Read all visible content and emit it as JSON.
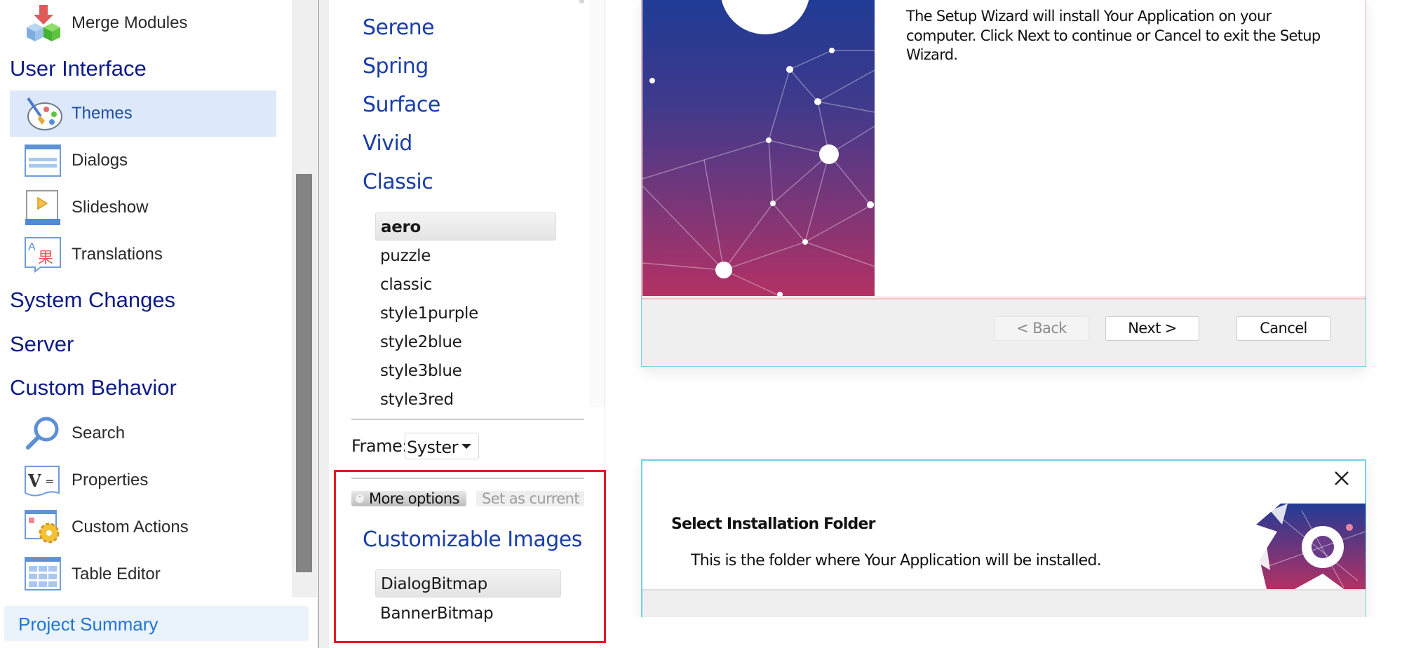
{
  "sidebar": {
    "top_item": {
      "label": "Merge Modules",
      "icon": "merge-modules-icon"
    },
    "sections": [
      {
        "title": "User Interface",
        "items": [
          {
            "label": "Themes",
            "icon": "palette-icon",
            "selected": true
          },
          {
            "label": "Dialogs",
            "icon": "dialog-window-icon"
          },
          {
            "label": "Slideshow",
            "icon": "slideshow-play-icon"
          },
          {
            "label": "Translations",
            "icon": "translation-icon"
          }
        ]
      },
      {
        "title": "System Changes",
        "items": []
      },
      {
        "title": "Server",
        "items": []
      },
      {
        "title": "Custom Behavior",
        "items": [
          {
            "label": "Search",
            "icon": "magnifier-icon"
          },
          {
            "label": "Properties",
            "icon": "properties-v-icon"
          },
          {
            "label": "Custom Actions",
            "icon": "gear-window-icon"
          },
          {
            "label": "Table Editor",
            "icon": "table-icon"
          }
        ]
      }
    ],
    "project_summary": "Project Summary"
  },
  "themes_panel": {
    "theme_groups": [
      "Serene",
      "Spring",
      "Surface",
      "Vivid",
      "Classic"
    ],
    "classic_styles": [
      {
        "label": "aero",
        "selected": true
      },
      {
        "label": "puzzle"
      },
      {
        "label": "classic"
      },
      {
        "label": "style1purple"
      },
      {
        "label": "style2blue"
      },
      {
        "label": "style3blue"
      },
      {
        "label": "style3red"
      }
    ],
    "frame_label": "Frame:",
    "frame_value": "Syster",
    "more_options_label": "More options",
    "set_as_current_label": "Set as current",
    "customizable_images_heading": "Customizable Images",
    "images": [
      {
        "label": "DialogBitmap",
        "selected": true
      },
      {
        "label": "BannerBitmap"
      }
    ],
    "highlight_color": "#e41b23"
  },
  "preview_welcome": {
    "description": "The Setup Wizard will install Your Application on your computer. Click Next to continue or Cancel to exit the Setup Wizard.",
    "buttons": {
      "back": "< Back",
      "next": "Next >",
      "cancel": "Cancel"
    },
    "back_enabled": false,
    "gradient_colors": [
      "#213b95",
      "#b33164"
    ]
  },
  "preview_folder": {
    "title": "Select Installation Folder",
    "subtitle": "This is the folder where Your Application will be installed.",
    "close_glyph": "✕"
  }
}
